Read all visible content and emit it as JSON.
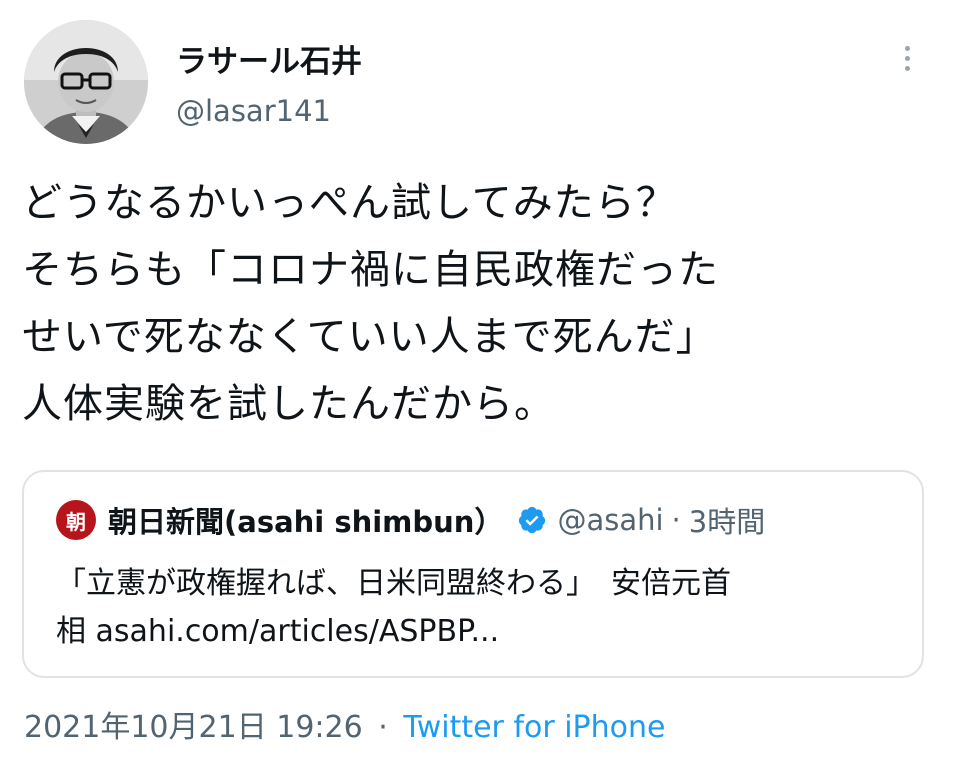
{
  "author": {
    "display_name": "ラサール石井",
    "handle": "@lasar141"
  },
  "tweet": {
    "lines": [
      "どうなるかいっぺん試してみたら？",
      "そちらも「コロナ禍に自民政権だった",
      "せいで死ななくていい人まで死んだ」",
      "人体実験を試したんだから。"
    ]
  },
  "quoted": {
    "avatar_glyph": "朝",
    "name": "朝日新聞(asahi shimbun）",
    "verified_icon": "verified-badge-icon",
    "handle": "@asahi",
    "separator": "·",
    "time": "3時間",
    "text_lines": [
      "「立憲が政権握れば、日米同盟終わる」　安倍元首",
      "相 asahi.com/articles/ASPBP..."
    ]
  },
  "footer": {
    "timestamp": "2021年10月21日 19:26",
    "separator": "·",
    "source": "Twitter for iPhone"
  },
  "colors": {
    "accent": "#1d9bf0",
    "secondary_text": "#536471",
    "asahi_red": "#b8141b"
  }
}
